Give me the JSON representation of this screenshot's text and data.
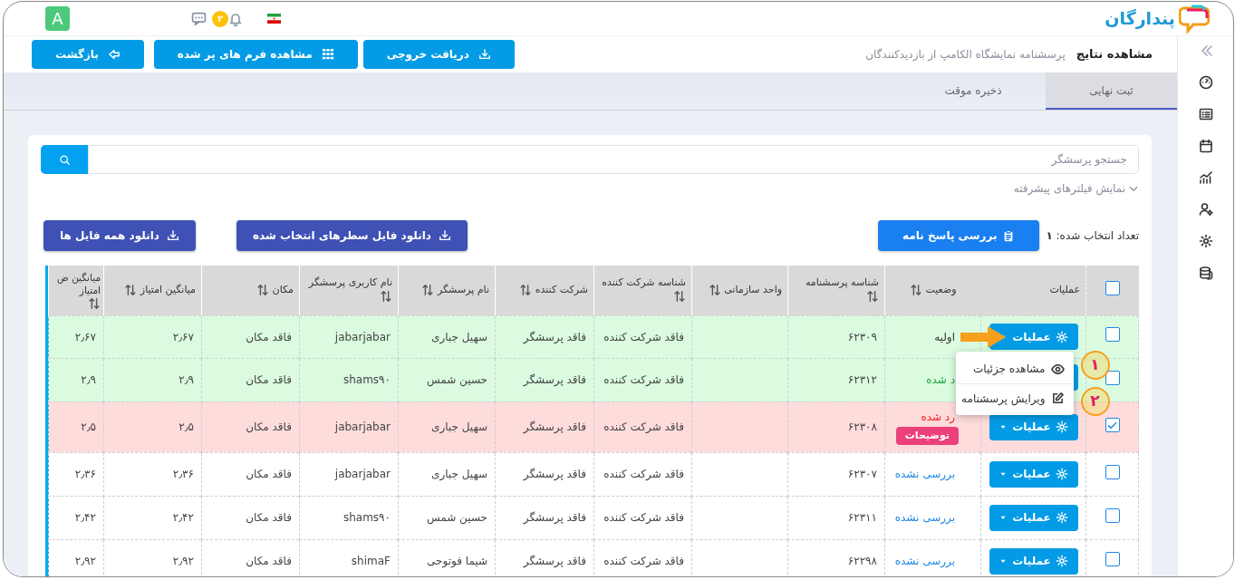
{
  "app": {
    "logo_text": "پندارگان",
    "avatar": "A",
    "notifications": "۲"
  },
  "header": {
    "title": "مشاهده نتایج",
    "subtitle": "پرسشنامه نمایشگاه الکامپ از بازدیدکنندگان",
    "buttons": [
      "دریافت خروجی",
      "مشاهده فرم های پر شده",
      "بازگشت"
    ]
  },
  "tabs": [
    {
      "label": "ثبت نهایی",
      "selected": true
    },
    {
      "label": "ذخیره موقت",
      "selected": false
    }
  ],
  "search": {
    "placeholder": "جستجو پرسشگر"
  },
  "advanced_filters": {
    "label": "نمایش فیلترهای پیشرفته",
    "expanded": false
  },
  "selection": {
    "label": "تعداد انتخاب شده:",
    "count": "۱"
  },
  "review_button": "بررسی پاسخ نامه",
  "download_buttons": [
    "دانلود فایل سطرهای انتخاب شده",
    "دانلود همه فایل ها"
  ],
  "table": {
    "select_all": {
      "checked": false
    },
    "columns": [
      {
        "label": "عملیات",
        "sortable": false
      },
      {
        "label": "وضعیت",
        "sortable": true
      },
      {
        "label": "شناسه پرسشنامه",
        "sortable": true
      },
      {
        "label": "واحد سازمانی",
        "sortable": true
      },
      {
        "label": "شناسه شرکت کننده",
        "sortable": true
      },
      {
        "label": "شرکت کننده",
        "sortable": true
      },
      {
        "label": "نام پرسشگر",
        "sortable": true
      },
      {
        "label": "نام کاربری پرسشگر",
        "sortable": true
      },
      {
        "label": "مکان",
        "sortable": true
      },
      {
        "label": "میانگین امتیاز",
        "sortable": true
      },
      {
        "label": "میانگین ض امتیاز",
        "sortable": true
      }
    ],
    "rows": [
      {
        "selected": false,
        "color": "#dafbe0",
        "pointed": true,
        "actions": "عملیات",
        "status": {
          "text": "اولیه",
          "kind": "plain"
        },
        "id": "۶۲۳۰۹",
        "participant_id": "فاقد شرکت کننده",
        "participant": "فاقد پرسشگر",
        "name": "سهیل جباری",
        "username": "jabarjabar",
        "location": "فاقد مکان",
        "avg": "۲٫۶۷",
        "avg2": "۲٫۶۷"
      },
      {
        "selected": false,
        "color": "#dafbe0",
        "pointed": false,
        "status": {
          "text": "د شده",
          "kind": "success"
        },
        "id": "۶۲۳۱۲",
        "participant_id": "فاقد شرکت کننده",
        "participant": "فاقد پرسشگر",
        "name": "حسین شمس",
        "username": "shams۹۰",
        "location": "فاقد مکان",
        "avg": "۲٫۹",
        "avg2": "۲٫۹"
      },
      {
        "selected": true,
        "color": "#ffdcdc",
        "pointed": false,
        "actions": "عملیات",
        "status": {
          "text": "رد شده",
          "kind": "danger",
          "badge": "توضیحات"
        },
        "id": "۶۲۳۰۸",
        "participant_id": "فاقد شرکت کننده",
        "participant": "فاقد پرسشگر",
        "name": "سهیل جباری",
        "username": "jabarjabar",
        "location": "فاقد مکان",
        "avg": "۲٫۵",
        "avg2": "۲٫۵"
      },
      {
        "selected": false,
        "pointed": false,
        "actions": "عملیات",
        "status": {
          "text": "بررسی نشده",
          "kind": "link"
        },
        "id": "۶۲۳۰۷",
        "participant_id": "فاقد شرکت کننده",
        "participant": "فاقد پرسشگر",
        "name": "سهیل جباری",
        "username": "jabarjabar",
        "location": "فاقد مکان",
        "avg": "۲٫۳۶",
        "avg2": "۲٫۳۶"
      },
      {
        "selected": false,
        "pointed": false,
        "actions": "عملیات",
        "status": {
          "text": "بررسی نشده",
          "kind": "link"
        },
        "id": "۶۲۳۱۱",
        "participant_id": "فاقد شرکت کننده",
        "participant": "فاقد پرسشگر",
        "name": "حسین شمس",
        "username": "shams۹۰",
        "location": "فاقد مکان",
        "avg": "۲٫۴۲",
        "avg2": "۲٫۴۲"
      },
      {
        "selected": false,
        "pointed": false,
        "actions": "عملیات",
        "status": {
          "text": "بررسی نشده",
          "kind": "link"
        },
        "id": "۶۲۲۹۸",
        "participant_id": "فاقد شرکت کننده",
        "participant": "فاقد پرسشگر",
        "name": "شیما فوتوحی",
        "username": "shimaF",
        "location": "فاقد مکان",
        "avg": "۲٫۹۲",
        "avg2": "۲٫۹۲"
      }
    ]
  },
  "row_menu": {
    "open": true,
    "items": [
      "مشاهده جزئیات",
      "ویرایش پرسشنامه"
    ]
  },
  "annotations": [
    {
      "label": "۱"
    },
    {
      "label": "۲"
    }
  ]
}
